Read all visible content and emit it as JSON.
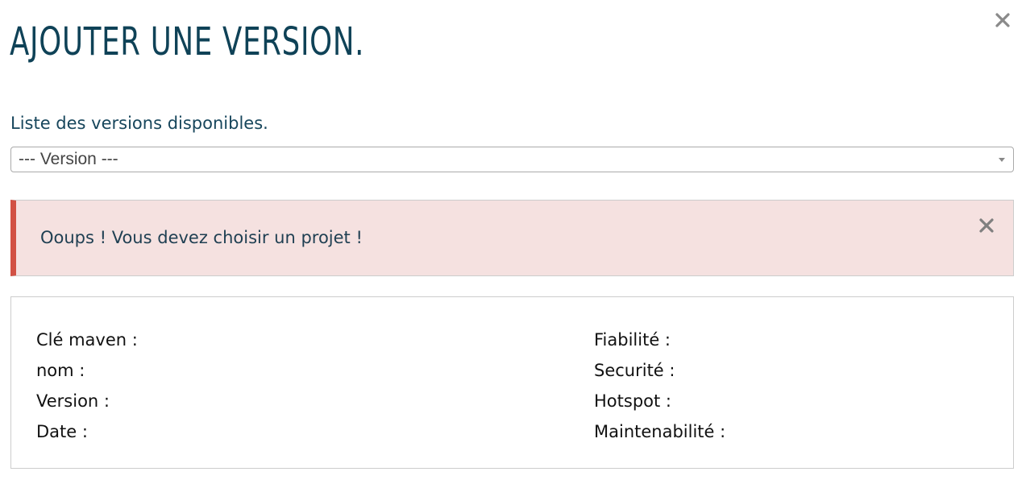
{
  "modal": {
    "title": "AJOUTER UNE VERSION.",
    "close_icon": "close-icon"
  },
  "version_selector": {
    "label": "Liste des versions disponibles.",
    "selected_value": "--- Version ---",
    "arrow_icon": "caret-down-icon"
  },
  "alert": {
    "message": "Ooups ! Vous devez choisir un projet !",
    "close_icon": "close-icon",
    "accent_color": "#d25144",
    "background_color": "#f5e1e0"
  },
  "details": {
    "left": [
      "Clé maven :",
      "nom :",
      "Version :",
      "Date :"
    ],
    "right": [
      "Fiabilité :",
      "Securité :",
      "Hotspot :",
      "Maintenabilité :"
    ]
  },
  "colors": {
    "title": "#0f4257",
    "label": "#17465c"
  }
}
